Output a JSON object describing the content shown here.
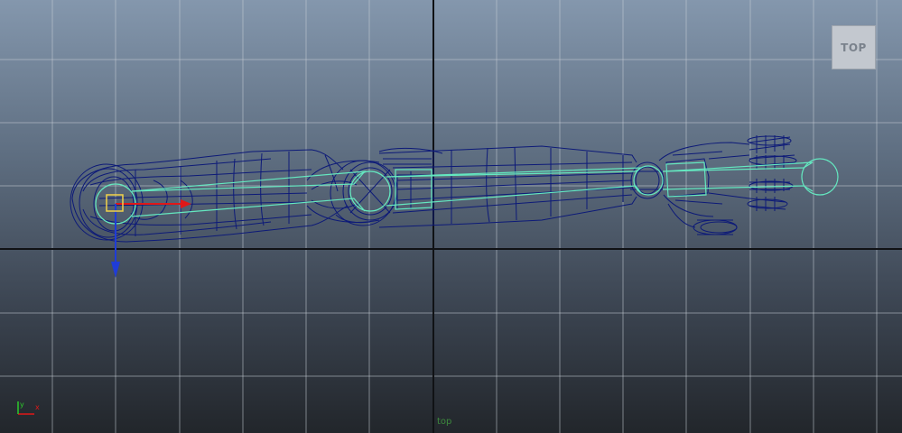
{
  "viewport": {
    "view_cube_label": "TOP",
    "camera_name": "top",
    "axis_labels": {
      "x": "x",
      "y": "y"
    },
    "colors": {
      "wireframe": "#0d1a78",
      "skeleton": "#64e8c0",
      "manipulator_x": "#e01818",
      "manipulator_z": "#1f3cd8",
      "selection": "#f2d24a",
      "grid": "#c6cdd6",
      "origin_axis": "#101215"
    }
  }
}
